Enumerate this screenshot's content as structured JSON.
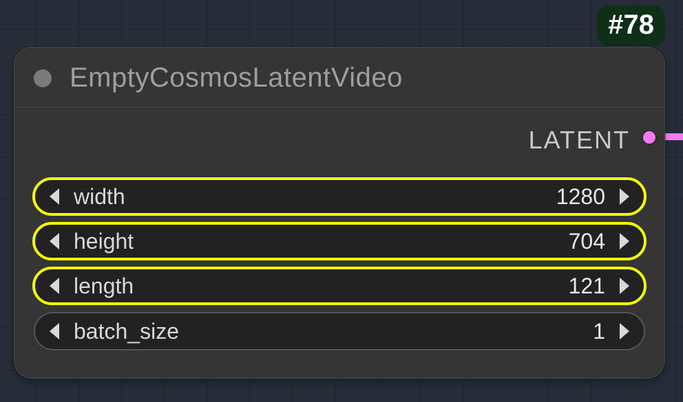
{
  "badge": {
    "text": "#78"
  },
  "node": {
    "title": "EmptyCosmosLatentVideo",
    "output": {
      "label": "LATENT",
      "port_color": "#f37bf0"
    },
    "params": [
      {
        "name": "width",
        "value": "1280",
        "highlighted": true
      },
      {
        "name": "height",
        "value": "704",
        "highlighted": true
      },
      {
        "name": "length",
        "value": "121",
        "highlighted": true
      },
      {
        "name": "batch_size",
        "value": "1",
        "highlighted": false
      }
    ]
  }
}
